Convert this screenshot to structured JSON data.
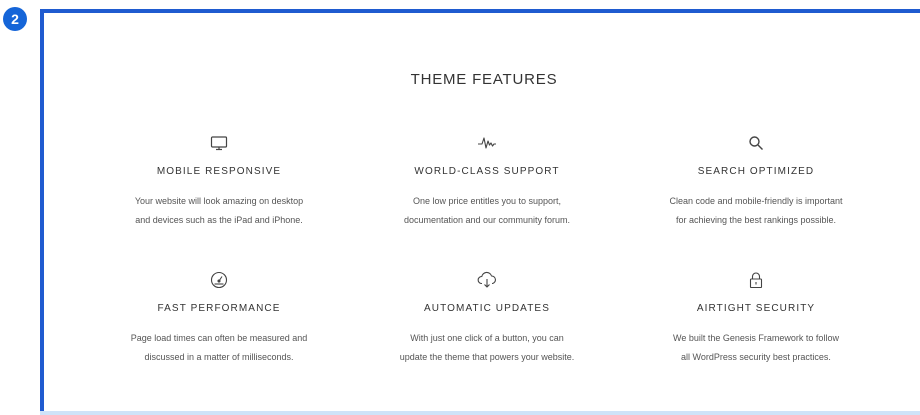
{
  "badge": {
    "number": "2",
    "color": "#1565d8"
  },
  "frame": {
    "border_color": "#1f5bd0"
  },
  "section": {
    "title": "THEME FEATURES"
  },
  "features": [
    {
      "icon": "monitor-icon",
      "heading": "MOBILE RESPONSIVE",
      "line1": "Your website will look amazing on desktop",
      "line2": "and devices such as the iPad and iPhone."
    },
    {
      "icon": "pulse-icon",
      "heading": "WORLD-CLASS SUPPORT",
      "line1": "One low price entitles you to support,",
      "line2": "documentation and our community forum."
    },
    {
      "icon": "search-icon",
      "heading": "SEARCH OPTIMIZED",
      "line1": "Clean code and mobile-friendly is important",
      "line2": "for achieving the best rankings possible."
    },
    {
      "icon": "speedometer-icon",
      "heading": "FAST PERFORMANCE",
      "line1": "Page load times can often be measured and",
      "line2": "discussed in a matter of milliseconds."
    },
    {
      "icon": "cloud-download-icon",
      "heading": "AUTOMATIC UPDATES",
      "line1": "With just one click of a button, you can",
      "line2": "update the theme that powers your website."
    },
    {
      "icon": "lock-icon",
      "heading": "AIRTIGHT SECURITY",
      "line1": "We built the Genesis Framework to follow",
      "line2": "all WordPress security best practices."
    }
  ]
}
